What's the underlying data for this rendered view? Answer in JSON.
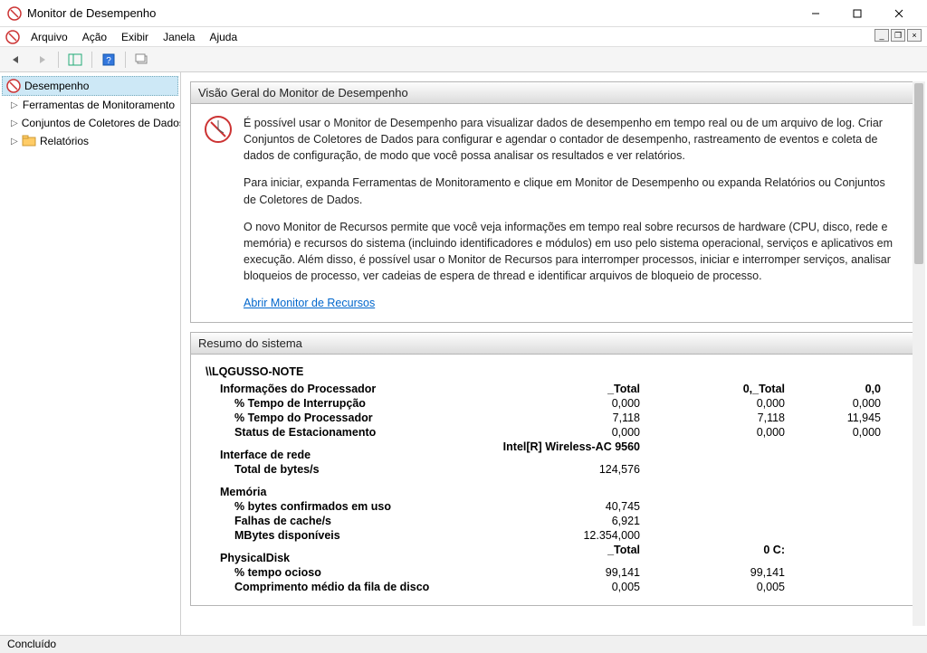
{
  "window": {
    "title": "Monitor de Desempenho"
  },
  "menu": {
    "arquivo": "Arquivo",
    "acao": "Ação",
    "exibir": "Exibir",
    "janela": "Janela",
    "ajuda": "Ajuda"
  },
  "tree": {
    "root": "Desempenho",
    "tools": "Ferramentas de Monitoramento",
    "collectors": "Conjuntos de Coletores de Dados",
    "reports": "Relatórios"
  },
  "overview": {
    "header": "Visão Geral do Monitor de Desempenho",
    "p1": "É possível usar o Monitor de Desempenho para visualizar dados de desempenho em tempo real ou de um arquivo de log. Criar Conjuntos de Coletores de Dados para configurar e agendar o contador de desempenho, rastreamento de eventos e coleta de dados de configuração, de modo que você possa analisar os resultados e ver relatórios.",
    "p2": "Para iniciar, expanda Ferramentas de Monitoramento e clique em Monitor de Desempenho ou expanda Relatórios ou Conjuntos de Coletores de Dados.",
    "p3": "O novo Monitor de Recursos permite que você veja informações em tempo real sobre recursos de hardware (CPU, disco, rede e memória) e recursos do sistema (incluindo identificadores e módulos) em uso pelo sistema operacional, serviços e aplicativos em execução. Além disso, é possível usar o Monitor de Recursos para interromper processos, iniciar e interromper serviços, analisar bloqueios de processo, ver cadeias de espera de thread e identificar arquivos de bloqueio de processo.",
    "link": "Abrir Monitor de Recursos"
  },
  "summary": {
    "header": "Resumo do sistema",
    "host": "\\\\LQGUSSO-NOTE",
    "proc": {
      "title": "Informações do Processador",
      "h1": "_Total",
      "h2": "0,_Total",
      "h3": "0,0",
      "r1": {
        "label": "% Tempo de Interrupção",
        "v1": "0,000",
        "v2": "0,000",
        "v3": "0,000"
      },
      "r2": {
        "label": "% Tempo do Processador",
        "v1": "7,118",
        "v2": "7,118",
        "v3": "11,945"
      },
      "r3": {
        "label": "Status de Estacionamento",
        "v1": "0,000",
        "v2": "0,000",
        "v3": "0,000"
      }
    },
    "net": {
      "title": "Interface de rede",
      "h1": "Intel[R] Wireless-AC 9560",
      "r1": {
        "label": "Total de bytes/s",
        "v1": "124,576"
      }
    },
    "mem": {
      "title": "Memória",
      "r1": {
        "label": "% bytes confirmados em uso",
        "v1": "40,745"
      },
      "r2": {
        "label": "Falhas de cache/s",
        "v1": "6,921"
      },
      "r3": {
        "label": "MBytes disponíveis",
        "v1": "12.354,000"
      }
    },
    "disk": {
      "title": "PhysicalDisk",
      "h1": "_Total",
      "h2": "0 C:",
      "r1": {
        "label": "% tempo ocioso",
        "v1": "99,141",
        "v2": "99,141"
      },
      "r2": {
        "label": "Comprimento médio da fila de disco",
        "v1": "0,005",
        "v2": "0,005"
      }
    }
  },
  "status": {
    "text": "Concluído"
  }
}
